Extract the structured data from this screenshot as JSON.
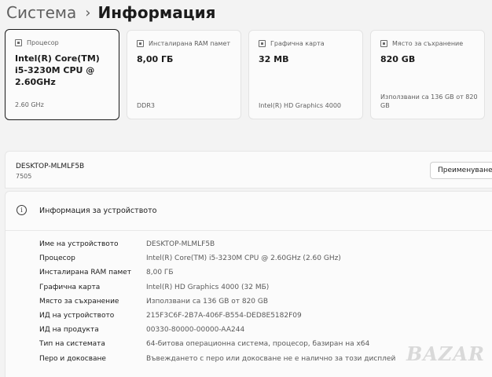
{
  "breadcrumb": {
    "parent": "Система",
    "separator": "›",
    "current": "Информация"
  },
  "cards": [
    {
      "label": "Процесор",
      "value": "Intel(R) Core(TM) i5-3230M CPU @ 2.60GHz",
      "sub": "2.60 GHz"
    },
    {
      "label": "Инсталирана RAM памет",
      "value": "8,00 ГБ",
      "sub": "DDR3"
    },
    {
      "label": "Графична карта",
      "value": "32 MB",
      "sub": "Intel(R) HD Graphics 4000"
    },
    {
      "label": "Място за съхранение",
      "value": "820 GB",
      "sub": "Използвани са 136 GB от 820 GB"
    }
  ],
  "device": {
    "name": "DESKTOP-MLMLF5B",
    "model": "7505",
    "rename_label": "Преименуване"
  },
  "info": {
    "icon": "info-icon",
    "title": "Информация за устройството",
    "rows": [
      {
        "label": "Име на устройството",
        "value": "DESKTOP-MLMLF5B"
      },
      {
        "label": "Процесор",
        "value": "Intel(R) Core(TM) i5-3230M CPU @ 2.60GHz (2.60 GHz)"
      },
      {
        "label": "Инсталирана RAM памет",
        "value": "8,00 ГБ"
      },
      {
        "label": "Графична карта",
        "value": "Intel(R) HD Graphics 4000 (32 МБ)"
      },
      {
        "label": "Място за съхранение",
        "value": "Използвани са 136 GB от 820 GB"
      },
      {
        "label": "ИД на устройството",
        "value": "215F3C6F-2B7A-406F-B554-DED8E5182F09"
      },
      {
        "label": "ИД на продукта",
        "value": "00330-80000-00000-AA244"
      },
      {
        "label": "Тип на системата",
        "value": "64-битова операционна система, процесор, базиран на x64"
      },
      {
        "label": "Перо и докосване",
        "value": "Въвеждането с перо или докосване не е налично за този дисплей"
      }
    ]
  },
  "watermark": "BAZAR"
}
